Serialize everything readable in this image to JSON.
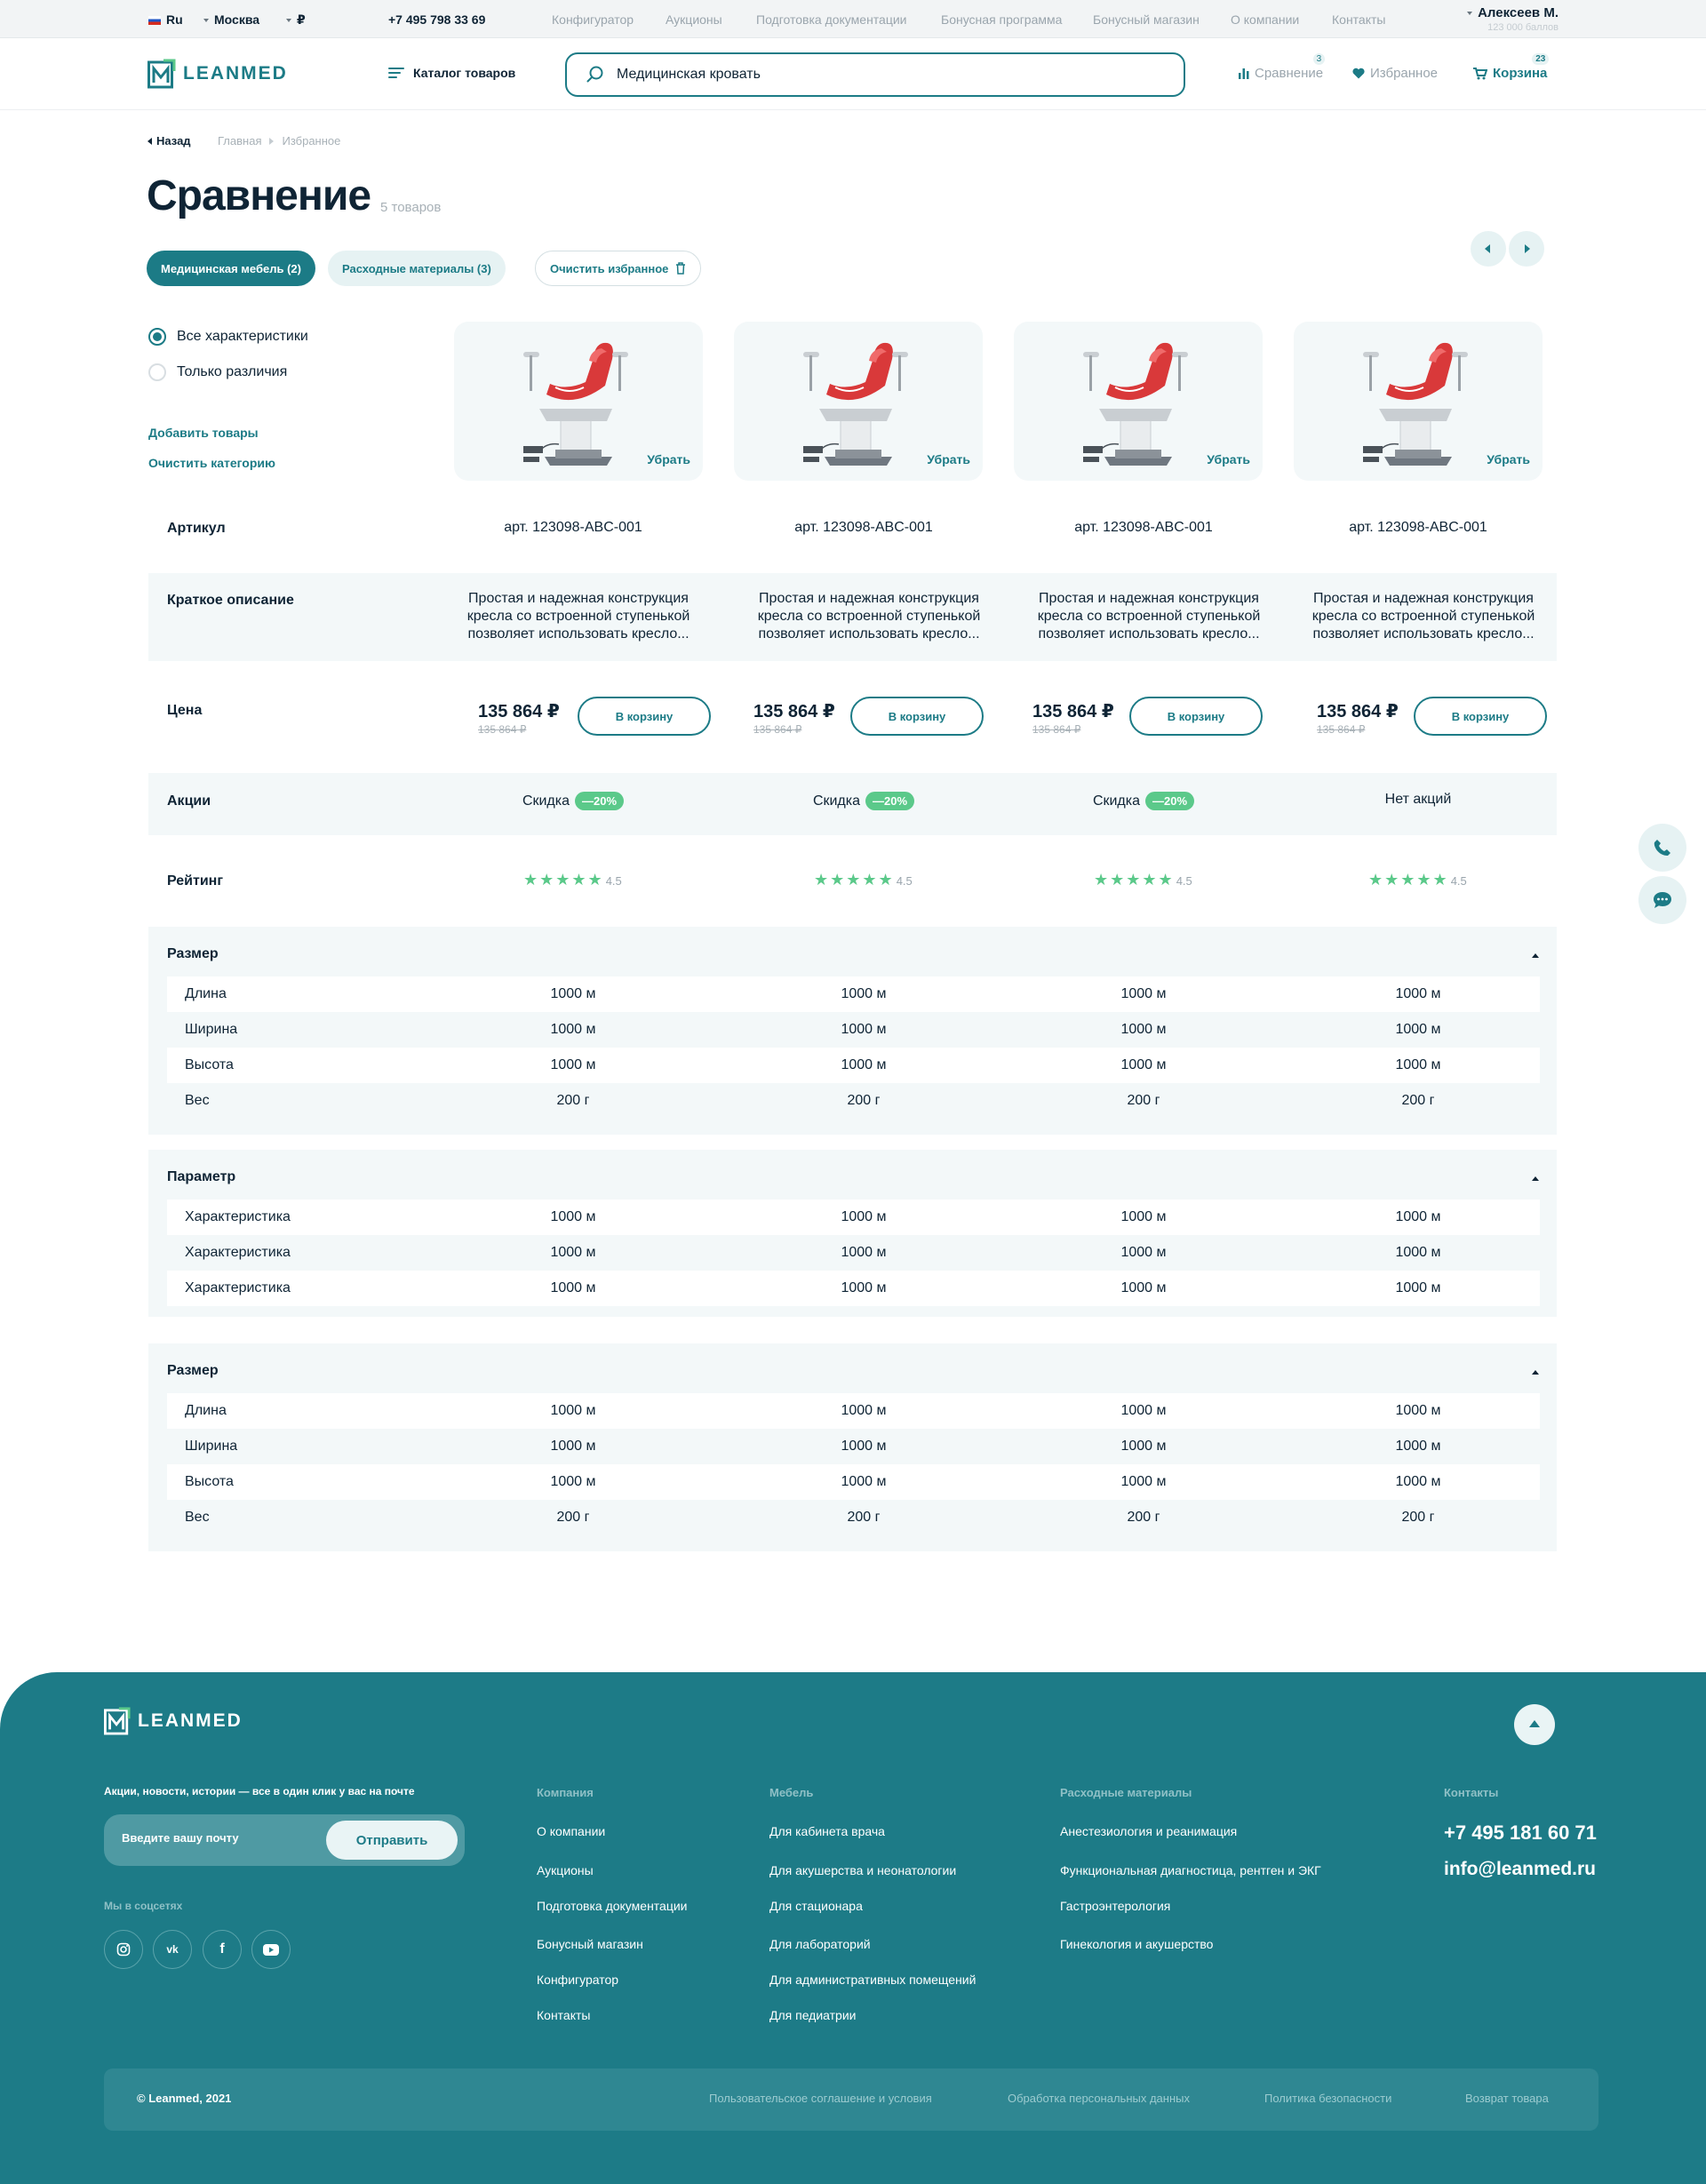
{
  "topbar": {
    "lang": "Ru",
    "city": "Москва",
    "currency": "₽",
    "phone": "+7 495 798 33 69",
    "links": [
      "Конфигуратор",
      "Аукционы",
      "Подготовка документации",
      "Бонусная программа",
      "Бонусный магазин",
      "О компании",
      "Контакты"
    ],
    "user_name": "Алексеев М.",
    "user_points": "123 000 баллов"
  },
  "header": {
    "logo": "LEANMED",
    "catalog": "Каталог товаров",
    "search_value": "Медицинская кровать",
    "compare": "Сравнение",
    "compare_count": "3",
    "favorites": "Избранное",
    "cart": "Корзина",
    "cart_count": "23"
  },
  "page": {
    "back": "Назад",
    "breadcrumbs": [
      "Главная",
      "Избранное"
    ],
    "title": "Сравнение",
    "count": "5 товаров",
    "chips": [
      "Медицинская мебель (2)",
      "Расходные материалы (3)"
    ],
    "clear_favorites": "Очистить избранное",
    "radio_all": "Все характеристики",
    "radio_diff": "Только различия",
    "add_products": "Добавить товары",
    "clear_category": "Очистить категорию",
    "remove": "Убрать"
  },
  "table": {
    "article_label": "Артикул",
    "articles": [
      "арт. 123098-ABC-001",
      "арт. 123098-ABC-001",
      "арт. 123098-ABC-001",
      "арт. 123098-ABC-001"
    ],
    "desc_label": "Краткое описание",
    "descs": [
      "Простая и надежная конструкция кресла со встроенной ступенькой позволяет использовать кресло...",
      "Простая и надежная конструкция кресла со встроенной ступенькой позволяет использовать кресло...",
      "Простая и надежная конструкция кресла со встроенной ступенькой позволяет использовать кресло...",
      "Простая и надежная конструкция кресла со встроенной ступенькой позволяет использовать кресло..."
    ],
    "price_label": "Цена",
    "prices": [
      "135 864 ₽",
      "135 864 ₽",
      "135 864 ₽",
      "135 864 ₽"
    ],
    "old_prices": [
      "135 864 ₽",
      "135 864 ₽",
      "135 864 ₽",
      "135 864 ₽"
    ],
    "to_cart": "В корзину",
    "promo_label": "Акции",
    "promos": [
      "Скидка",
      "Скидка",
      "Скидка",
      "Нет акций"
    ],
    "discount": "—20%",
    "rating_label": "Рейтинг",
    "rating": "4.5",
    "stars": 5,
    "groups": [
      {
        "title": "Размер",
        "rows": [
          {
            "name": "Длина",
            "vals": [
              "1000 м",
              "1000 м",
              "1000 м",
              "1000 м"
            ]
          },
          {
            "name": "Ширина",
            "vals": [
              "1000 м",
              "1000 м",
              "1000 м",
              "1000 м"
            ]
          },
          {
            "name": "Высота",
            "vals": [
              "1000 м",
              "1000 м",
              "1000 м",
              "1000 м"
            ]
          },
          {
            "name": "Вес",
            "vals": [
              "200 г",
              "200 г",
              "200 г",
              "200 г"
            ]
          }
        ]
      },
      {
        "title": "Параметр",
        "rows": [
          {
            "name": "Характеристика",
            "vals": [
              "1000 м",
              "1000 м",
              "1000 м",
              "1000 м"
            ]
          },
          {
            "name": "Характеристика",
            "vals": [
              "1000 м",
              "1000 м",
              "1000 м",
              "1000 м"
            ]
          },
          {
            "name": "Характеристика",
            "vals": [
              "1000 м",
              "1000 м",
              "1000 м",
              "1000 м"
            ]
          }
        ]
      },
      {
        "title": "Размер",
        "rows": [
          {
            "name": "Длина",
            "vals": [
              "1000 м",
              "1000 м",
              "1000 м",
              "1000 м"
            ]
          },
          {
            "name": "Ширина",
            "vals": [
              "1000 м",
              "1000 м",
              "1000 м",
              "1000 м"
            ]
          },
          {
            "name": "Высота",
            "vals": [
              "1000 м",
              "1000 м",
              "1000 м",
              "1000 м"
            ]
          },
          {
            "name": "Вес",
            "vals": [
              "200 г",
              "200 г",
              "200 г",
              "200 г"
            ]
          }
        ]
      }
    ]
  },
  "footer": {
    "logo": "LEANMED",
    "newsletter": "Акции, новости, истории — все в один клик у вас на почте",
    "email_placeholder": "Введите вашу почту",
    "send": "Отправить",
    "social_title": "Мы в соцсетях",
    "col_company_title": "Компания",
    "col_company": [
      "О компании",
      "Аукционы",
      "Подготовка документации",
      "Бонусный магазин",
      "Конфигуратор",
      "Контакты"
    ],
    "col_furniture_title": "Мебель",
    "col_furniture": [
      "Для кабинета врача",
      "Для акушерства и неонатологии",
      "Для стационара",
      "Для лабораторий",
      "Для административных помещений",
      "Для педиатрии"
    ],
    "col_supplies_title": "Расходные материалы",
    "col_supplies": [
      "Анестезиология и реанимация",
      "Функциональная диагностица, рентген и ЭКГ",
      "Гастроэнтерология",
      "Гинекология и акушерство"
    ],
    "contacts_title": "Контакты",
    "phone": "+7 495 181 60 71",
    "email": "info@leanmed.ru",
    "copyright": "© Leanmed, 2021",
    "bottom_links": [
      "Пользовательское соглашение и условия",
      "Обработка персональных данных",
      "Политика безопасности",
      "Возврат товара"
    ]
  },
  "colors": {
    "accent": "#1c7b86",
    "footer": "#1d7b87",
    "discount": "#5bc98a",
    "band": "#f3f8f9"
  }
}
